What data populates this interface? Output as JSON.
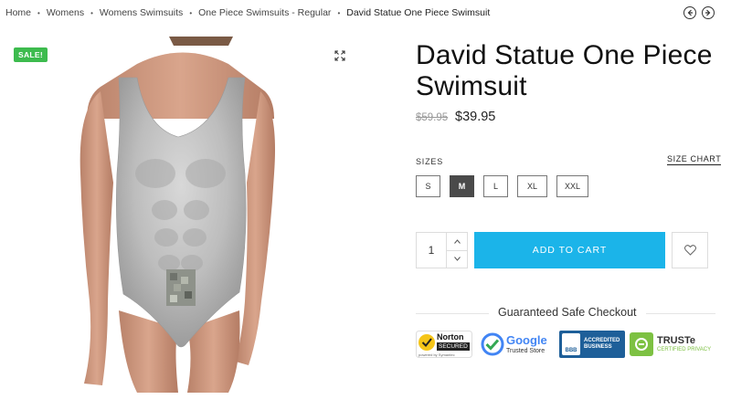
{
  "breadcrumb": {
    "items": [
      "Home",
      "Womens",
      "Womens Swimsuits",
      "One Piece Swimsuits - Regular"
    ],
    "current": "David Statue One Piece Swimsuit",
    "separator": "•"
  },
  "pager": {
    "prev_icon": "arrow-left-circle-icon",
    "next_icon": "arrow-right-circle-icon"
  },
  "image": {
    "sale_badge": "SALE!",
    "expand_icon": "expand-arrows-icon"
  },
  "product": {
    "title": "David Statue One Piece Swimsuit",
    "price_old": "$59.95",
    "price_new": "$39.95"
  },
  "sizes": {
    "label": "SIZES",
    "chart_link": "SIZE CHART",
    "options": [
      "S",
      "M",
      "L",
      "XL",
      "XXL"
    ],
    "selected": "M"
  },
  "cart": {
    "quantity": "1",
    "add_label": "ADD TO CART",
    "wishlist_icon": "heart-icon"
  },
  "checkout": {
    "title": "Guaranteed Safe Checkout",
    "badges": {
      "norton_line1": "Norton",
      "norton_line2": "SECURED",
      "norton_line3": "powered by Symantec",
      "google_word": "Google",
      "google_sub": "Trusted Store",
      "bbb_logo": "BBB",
      "bbb_line1": "ACCREDITED",
      "bbb_line2": "BUSINESS",
      "truste_word": "TRUSTe",
      "truste_sub": "CERTIFIED PRIVACY"
    }
  },
  "colors": {
    "accent": "#1bb4e9",
    "sale": "#3dbb4e",
    "selected_size": "#4a4a4a"
  }
}
